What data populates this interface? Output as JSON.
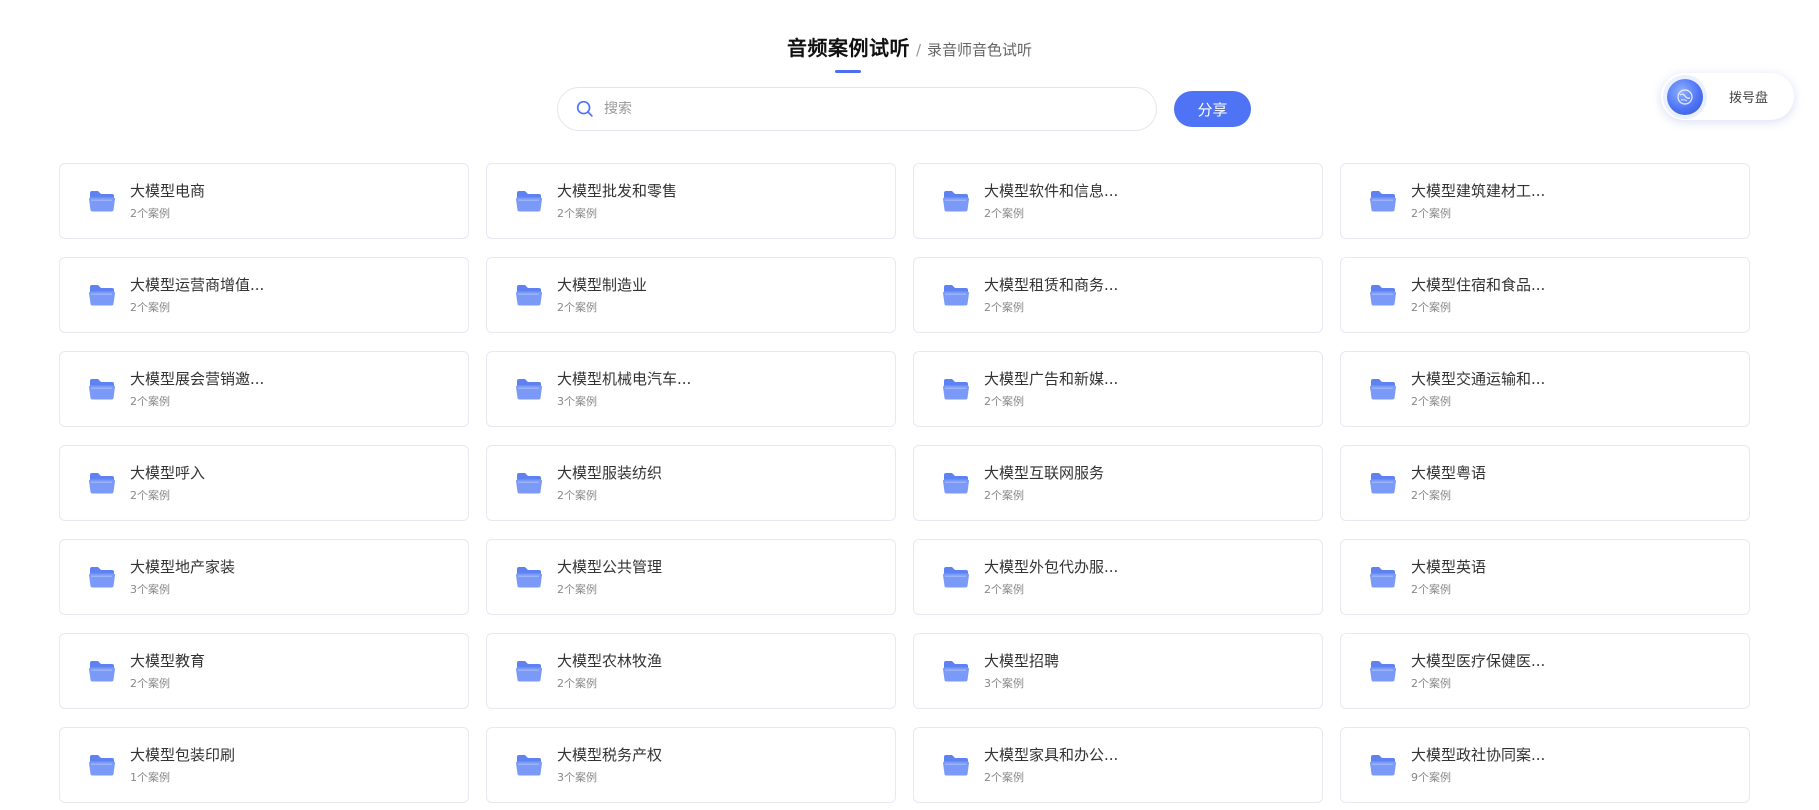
{
  "header": {
    "title": "音频案例试听",
    "separator": "/",
    "subtitle": "录音师音色试听"
  },
  "search": {
    "placeholder": "搜索",
    "value": "",
    "icon": "search-icon"
  },
  "share_button": {
    "label": "分享"
  },
  "dialpad": {
    "label": "拨号盘",
    "icon": "dialpad-globe-icon"
  },
  "colors": {
    "accent": "#4e74f5",
    "folder": "#7b9af7",
    "card_border": "#e6e9f3"
  },
  "folder_icon": "folder-icon",
  "categories": [
    {
      "title": "大模型电商",
      "count": "2个案例"
    },
    {
      "title": "大模型批发和零售",
      "count": "2个案例"
    },
    {
      "title": "大模型软件和信息...",
      "count": "2个案例"
    },
    {
      "title": "大模型建筑建材工...",
      "count": "2个案例"
    },
    {
      "title": "大模型运营商增值...",
      "count": "2个案例"
    },
    {
      "title": "大模型制造业",
      "count": "2个案例"
    },
    {
      "title": "大模型租赁和商务...",
      "count": "2个案例"
    },
    {
      "title": "大模型住宿和食品...",
      "count": "2个案例"
    },
    {
      "title": "大模型展会营销邀...",
      "count": "2个案例"
    },
    {
      "title": "大模型机械电汽车...",
      "count": "3个案例"
    },
    {
      "title": "大模型广告和新媒...",
      "count": "2个案例"
    },
    {
      "title": "大模型交通运输和...",
      "count": "2个案例"
    },
    {
      "title": "大模型呼入",
      "count": "2个案例"
    },
    {
      "title": "大模型服装纺织",
      "count": "2个案例"
    },
    {
      "title": "大模型互联网服务",
      "count": "2个案例"
    },
    {
      "title": "大模型粤语",
      "count": "2个案例"
    },
    {
      "title": "大模型地产家装",
      "count": "3个案例"
    },
    {
      "title": "大模型公共管理",
      "count": "2个案例"
    },
    {
      "title": "大模型外包代办服...",
      "count": "2个案例"
    },
    {
      "title": "大模型英语",
      "count": "2个案例"
    },
    {
      "title": "大模型教育",
      "count": "2个案例"
    },
    {
      "title": "大模型农林牧渔",
      "count": "2个案例"
    },
    {
      "title": "大模型招聘",
      "count": "3个案例"
    },
    {
      "title": "大模型医疗保健医...",
      "count": "2个案例"
    },
    {
      "title": "大模型包装印刷",
      "count": "1个案例"
    },
    {
      "title": "大模型税务产权",
      "count": "3个案例"
    },
    {
      "title": "大模型家具和办公...",
      "count": "2个案例"
    },
    {
      "title": "大模型政社协同案...",
      "count": "9个案例"
    }
  ]
}
